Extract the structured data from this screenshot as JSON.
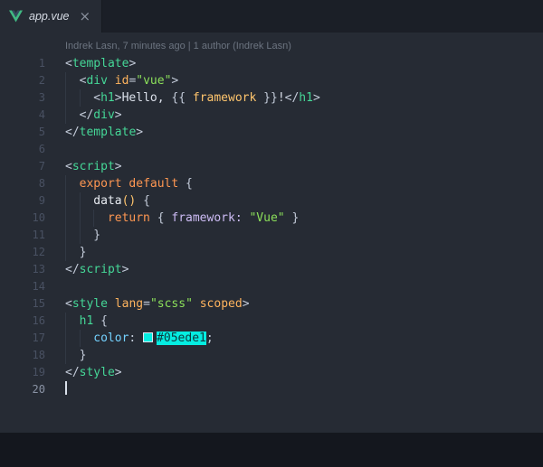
{
  "tab_bar": {
    "tab": {
      "filename": "app.vue",
      "close_label": "×"
    }
  },
  "blame": {
    "text": "Indrek Lasn, 7 minutes ago | 1 author (Indrek Lasn)"
  },
  "colors": {
    "tag": "#45d797",
    "punct": "#c3cbd9",
    "attr": "#ffb45e",
    "string": "#8ce05a",
    "keyword": "#ff9752",
    "text": "#dbe0ea",
    "prop": "#cdbcf5",
    "func": "#e8ecf2",
    "var": "#ffc56d",
    "cssprop": "#74d2ff",
    "swatch": "#05ede1",
    "hextext": "#0d3a3f",
    "vue_green": "#41b883",
    "vue_dark": "#35495e"
  },
  "editor": {
    "lines": [
      {
        "num": "1",
        "guides": 0,
        "tokens": [
          {
            "t": "<",
            "c": "punct"
          },
          {
            "t": "template",
            "c": "tag"
          },
          {
            "t": ">",
            "c": "punct"
          }
        ]
      },
      {
        "num": "2",
        "guides": 1,
        "tokens": [
          {
            "t": "<",
            "c": "punct"
          },
          {
            "t": "div",
            "c": "tag"
          },
          {
            "t": " ",
            "c": "text"
          },
          {
            "t": "id",
            "c": "attr"
          },
          {
            "t": "=",
            "c": "punct"
          },
          {
            "t": "\"vue\"",
            "c": "string"
          },
          {
            "t": ">",
            "c": "punct"
          }
        ]
      },
      {
        "num": "3",
        "guides": 2,
        "tokens": [
          {
            "t": "<",
            "c": "punct"
          },
          {
            "t": "h1",
            "c": "tag"
          },
          {
            "t": ">",
            "c": "punct"
          },
          {
            "t": "Hello, ",
            "c": "text"
          },
          {
            "t": "{{ ",
            "c": "punct"
          },
          {
            "t": "framework",
            "c": "var"
          },
          {
            "t": " }}",
            "c": "punct"
          },
          {
            "t": "!",
            "c": "text"
          },
          {
            "t": "</",
            "c": "punct"
          },
          {
            "t": "h1",
            "c": "tag"
          },
          {
            "t": ">",
            "c": "punct"
          }
        ]
      },
      {
        "num": "4",
        "guides": 1,
        "tokens": [
          {
            "t": "</",
            "c": "punct"
          },
          {
            "t": "div",
            "c": "tag"
          },
          {
            "t": ">",
            "c": "punct"
          }
        ]
      },
      {
        "num": "5",
        "guides": 0,
        "tokens": [
          {
            "t": "</",
            "c": "punct"
          },
          {
            "t": "template",
            "c": "tag"
          },
          {
            "t": ">",
            "c": "punct"
          }
        ]
      },
      {
        "num": "6",
        "guides": 0,
        "tokens": []
      },
      {
        "num": "7",
        "guides": 0,
        "tokens": [
          {
            "t": "<",
            "c": "punct"
          },
          {
            "t": "script",
            "c": "tag"
          },
          {
            "t": ">",
            "c": "punct"
          }
        ]
      },
      {
        "num": "8",
        "guides": 1,
        "tokens": [
          {
            "t": "export default",
            "c": "keyword"
          },
          {
            "t": " ",
            "c": "text"
          },
          {
            "t": "{",
            "c": "punct"
          }
        ]
      },
      {
        "num": "9",
        "guides": 2,
        "tokens": [
          {
            "t": "data",
            "c": "func"
          },
          {
            "t": "()",
            "c": "var"
          },
          {
            "t": " ",
            "c": "text"
          },
          {
            "t": "{",
            "c": "punct"
          }
        ]
      },
      {
        "num": "10",
        "guides": 3,
        "tokens": [
          {
            "t": "return",
            "c": "keyword"
          },
          {
            "t": " ",
            "c": "text"
          },
          {
            "t": "{",
            "c": "punct"
          },
          {
            "t": " ",
            "c": "text"
          },
          {
            "t": "framework:",
            "c": "prop"
          },
          {
            "t": " ",
            "c": "text"
          },
          {
            "t": "\"Vue\"",
            "c": "string"
          },
          {
            "t": " ",
            "c": "text"
          },
          {
            "t": "}",
            "c": "punct"
          }
        ]
      },
      {
        "num": "11",
        "guides": 2,
        "tokens": [
          {
            "t": "}",
            "c": "punct"
          }
        ]
      },
      {
        "num": "12",
        "guides": 1,
        "tokens": [
          {
            "t": "}",
            "c": "punct"
          }
        ]
      },
      {
        "num": "13",
        "guides": 0,
        "tokens": [
          {
            "t": "</",
            "c": "punct"
          },
          {
            "t": "script",
            "c": "tag"
          },
          {
            "t": ">",
            "c": "punct"
          }
        ]
      },
      {
        "num": "14",
        "guides": 0,
        "tokens": []
      },
      {
        "num": "15",
        "guides": 0,
        "tokens": [
          {
            "t": "<",
            "c": "punct"
          },
          {
            "t": "style",
            "c": "tag"
          },
          {
            "t": " ",
            "c": "text"
          },
          {
            "t": "lang",
            "c": "attr"
          },
          {
            "t": "=",
            "c": "punct"
          },
          {
            "t": "\"scss\"",
            "c": "string"
          },
          {
            "t": " ",
            "c": "text"
          },
          {
            "t": "scoped",
            "c": "attr"
          },
          {
            "t": ">",
            "c": "punct"
          }
        ]
      },
      {
        "num": "16",
        "guides": 1,
        "tokens": [
          {
            "t": "h1",
            "c": "tag"
          },
          {
            "t": " ",
            "c": "text"
          },
          {
            "t": "{",
            "c": "punct"
          }
        ]
      },
      {
        "num": "17",
        "guides": 2,
        "tokens": [
          {
            "t": "color",
            "c": "cssprop"
          },
          {
            "t": ":",
            "c": "punct"
          },
          {
            "t": " ",
            "c": "text"
          },
          {
            "c": "swatch"
          },
          {
            "t": "#05ede1",
            "c": "hexval"
          },
          {
            "t": ";",
            "c": "punct"
          }
        ]
      },
      {
        "num": "18",
        "guides": 1,
        "tokens": [
          {
            "t": "}",
            "c": "punct"
          }
        ]
      },
      {
        "num": "19",
        "guides": 0,
        "tokens": [
          {
            "t": "</",
            "c": "punct"
          },
          {
            "t": "style",
            "c": "tag"
          },
          {
            "t": ">",
            "c": "punct"
          }
        ]
      },
      {
        "num": "20",
        "guides": 0,
        "tokens": [],
        "cursor": true,
        "active": true
      }
    ]
  }
}
